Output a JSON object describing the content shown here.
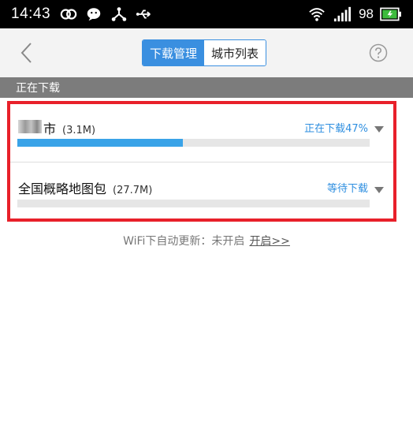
{
  "status_bar": {
    "time": "14:43",
    "battery": "98",
    "icons": [
      "infinity-icon",
      "wechat-icon",
      "share-icon",
      "usb-icon",
      "wifi-icon",
      "signal-icon",
      "battery-icon"
    ]
  },
  "tabs": [
    {
      "label": "下载管理",
      "active": true
    },
    {
      "label": "城市列表",
      "active": false
    }
  ],
  "section": {
    "title": "正在下载"
  },
  "downloads": [
    {
      "name": "市",
      "size": "(3.1M)",
      "status": "正在下载47%",
      "progress": 0.47,
      "name_partially_obscured": true
    },
    {
      "name": "全国概略地图包",
      "size": "(27.7M)",
      "status": "等待下载",
      "progress": 0
    }
  ],
  "wifi": {
    "text": "WiFi下自动更新：未开启",
    "link": "开启>>"
  },
  "colors": {
    "accent": "#3a8fe0",
    "highlight": "#e8202a",
    "progress": "#3aa3e8",
    "section_bg": "#7c7c7c"
  }
}
